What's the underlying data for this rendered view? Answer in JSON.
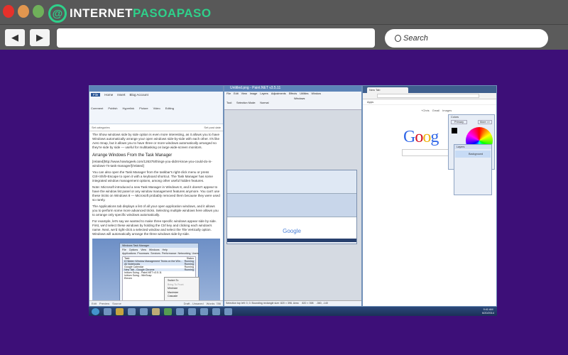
{
  "browser": {
    "logo_part1": "INTERNET",
    "logo_part2": "PASOAPASO",
    "back_icon": "◀",
    "forward_icon": "▶",
    "url_value": "",
    "search_placeholder": "Search",
    "colors": {
      "bg": "#3d0f78",
      "accent": "#2ed08a"
    }
  },
  "word": {
    "tabs": [
      "File",
      "Home",
      "Insert",
      "Blog Account"
    ],
    "ribbon_items": [
      "Comment",
      "Publish",
      "Hyperlink",
      "Picture",
      "Video",
      "Editing"
    ],
    "category": "Set categories",
    "post_date": "Set post date",
    "paragraphs": [
      "The Show windows side by side option is even more interesting, as it allows you to have Windows automatically arrange your open windows side-by-side with each other. It's like Aero Snap, but it allows you to have three or more windows automatically arranged so they're side by side — useful for multitasking on large wide-screen monitors.",
      "Arrange Windows From the Task Manager",
      "[related]http://www.howtogeek.com/126375/things-you-didnt-know-you-could-do-in-windows-7s-task-manager/[/related]",
      "You can also open the Task Manager from the taskbar's right-click menu or press Ctrl+Shift+Escape to open it with a keyboard shortcut. The Task Manager has some integrated window management options, among other useful hidden features.",
      "Note: Microsoft introduced a new Task Manager in Windows 8, and it doesn't appear to have the window list panel or any window management features anymore. You can't use these tricks on Windows 8 — Microsoft probably removed them because they were used so rarely.",
      "The Applications tab displays a list of all your open application windows, and it allows you to perform some more advanced tricks. Selecting multiple windows here allows you to arrange only specific windows automatically.",
      "For example, let's say we wanted to make three specific windows appear side by side. First, we'd select these windows by holding the Ctrl key and clicking each window's name. Next, we'd right-click a selected window and select the Tile Vertically option. Windows will automatically arrange the three windows side-by-side."
    ],
    "taskmgr": {
      "title": "Windows Task Manager",
      "menu": [
        "File",
        "Options",
        "View",
        "Windows",
        "Help"
      ],
      "tabs": [
        "Applications",
        "Processes",
        "Services",
        "Performance",
        "Networking",
        "Users"
      ],
      "columns": [
        "Task",
        "Status"
      ],
      "rows": [
        [
          "8 Hidden Window Management Tricks on the Win...",
          "Running"
        ],
        [
          "All Notebooks",
          "Running"
        ],
        [
          "Google Calendar",
          "Running"
        ],
        [
          "New Tab - Google Chrome",
          "Running"
        ],
        [
          "Initium Suing - Paint.NET v3.5.11",
          "Running"
        ],
        [
          "Initium Suing - WinSnap",
          "Running"
        ],
        [
          "Eleven",
          ""
        ]
      ],
      "context_menu": [
        "Switch To",
        "Bring To Front",
        "Minimize",
        "Maximize",
        "Cascade"
      ]
    },
    "bottom_tabs": [
      "Edit",
      "Preview",
      "Source"
    ],
    "status": "Draft - Unsaved",
    "word_count": "Words: 786"
  },
  "paint": {
    "title": "Untitled.png - Paint.NET v3.5.11",
    "menu": [
      "File",
      "Edit",
      "View",
      "Image",
      "Layers",
      "Adjustments",
      "Effects",
      "Utilities",
      "Window"
    ],
    "tool_label": "Tool:",
    "selection_mode": "Selection Mode:",
    "blend": "Normal",
    "windows_label": "Windows",
    "status": "Selection top left: 0, 0. Bounding rectangle size: 820 × 396. Area:",
    "size": "820 × 398",
    "coords": "-360, -140"
  },
  "chrome": {
    "tab_title": "New Tab",
    "apps_label": "Apps",
    "links": [
      "+Chris",
      "Gmail",
      "Images"
    ],
    "google": "Google",
    "colors_panel": {
      "title": "Colors",
      "primary": "Primary",
      "more": "More >>"
    },
    "layers_panel": {
      "title": "Layers",
      "layer": "Background"
    },
    "clock_time": "9:41 AM",
    "clock_date": "6/20/2014"
  }
}
